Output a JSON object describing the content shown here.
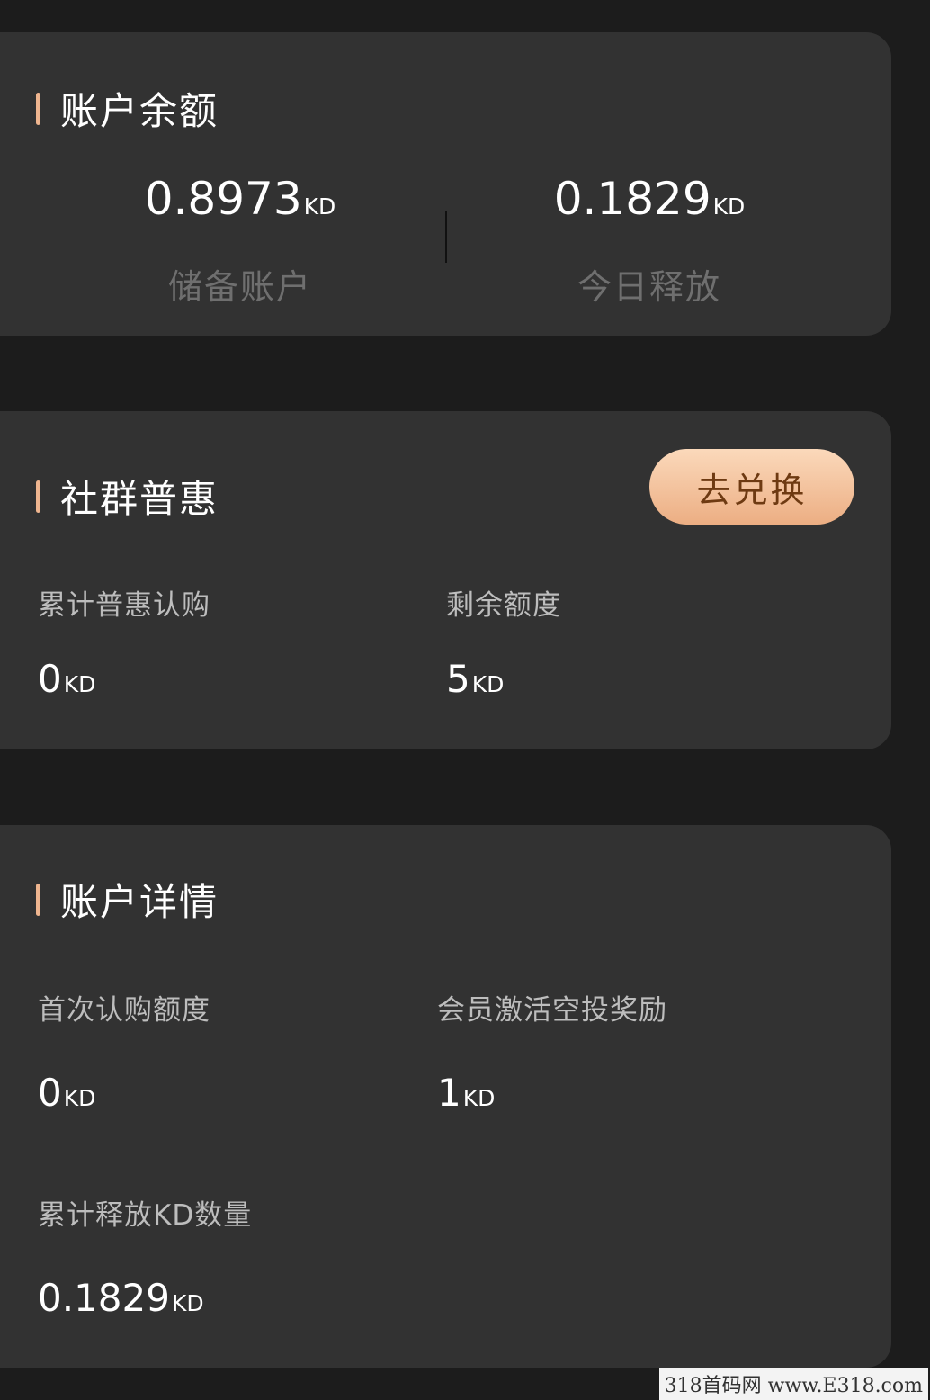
{
  "balance": {
    "title": "账户余额",
    "reserve": {
      "value": "0.8973",
      "unit": "KD",
      "label": "储备账户"
    },
    "today_release": {
      "value": "0.1829",
      "unit": "KD",
      "label": "今日释放"
    }
  },
  "community": {
    "title": "社群普惠",
    "exchange_button_label": "去兑换",
    "total_subscribed": {
      "label": "累计普惠认购",
      "value": "0",
      "unit": "KD"
    },
    "remaining_quota": {
      "label": "剩余额度",
      "value": "5",
      "unit": "KD"
    }
  },
  "details": {
    "title": "账户详情",
    "first_subscription": {
      "label": "首次认购额度",
      "value": "0",
      "unit": "KD"
    },
    "airdrop_reward": {
      "label": "会员激活空投奖励",
      "value": "1",
      "unit": "KD"
    },
    "total_released": {
      "label": "累计释放KD数量",
      "value": "0.1829",
      "unit": "KD"
    }
  },
  "watermark": "318首码网 www.E318.com",
  "colors": {
    "page_bg": "#1c1c1c",
    "card_bg": "#323232",
    "accent": "#efb58f",
    "button_text": "#6e3a12"
  }
}
